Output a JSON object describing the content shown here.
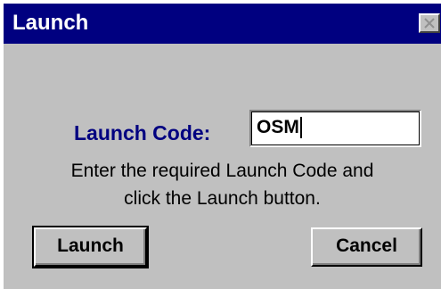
{
  "window": {
    "title": "Launch",
    "close_icon": "close-x-icon"
  },
  "form": {
    "code_label": "Launch Code:",
    "code_value": "OSM",
    "instruction_line1": "Enter the required Launch Code and",
    "instruction_line2": "click the Launch button."
  },
  "buttons": {
    "launch_label": "Launch",
    "cancel_label": "Cancel"
  },
  "colors": {
    "titlebar": "#000080",
    "dialog_bg": "#c0c0c0",
    "label_color": "#000080"
  }
}
